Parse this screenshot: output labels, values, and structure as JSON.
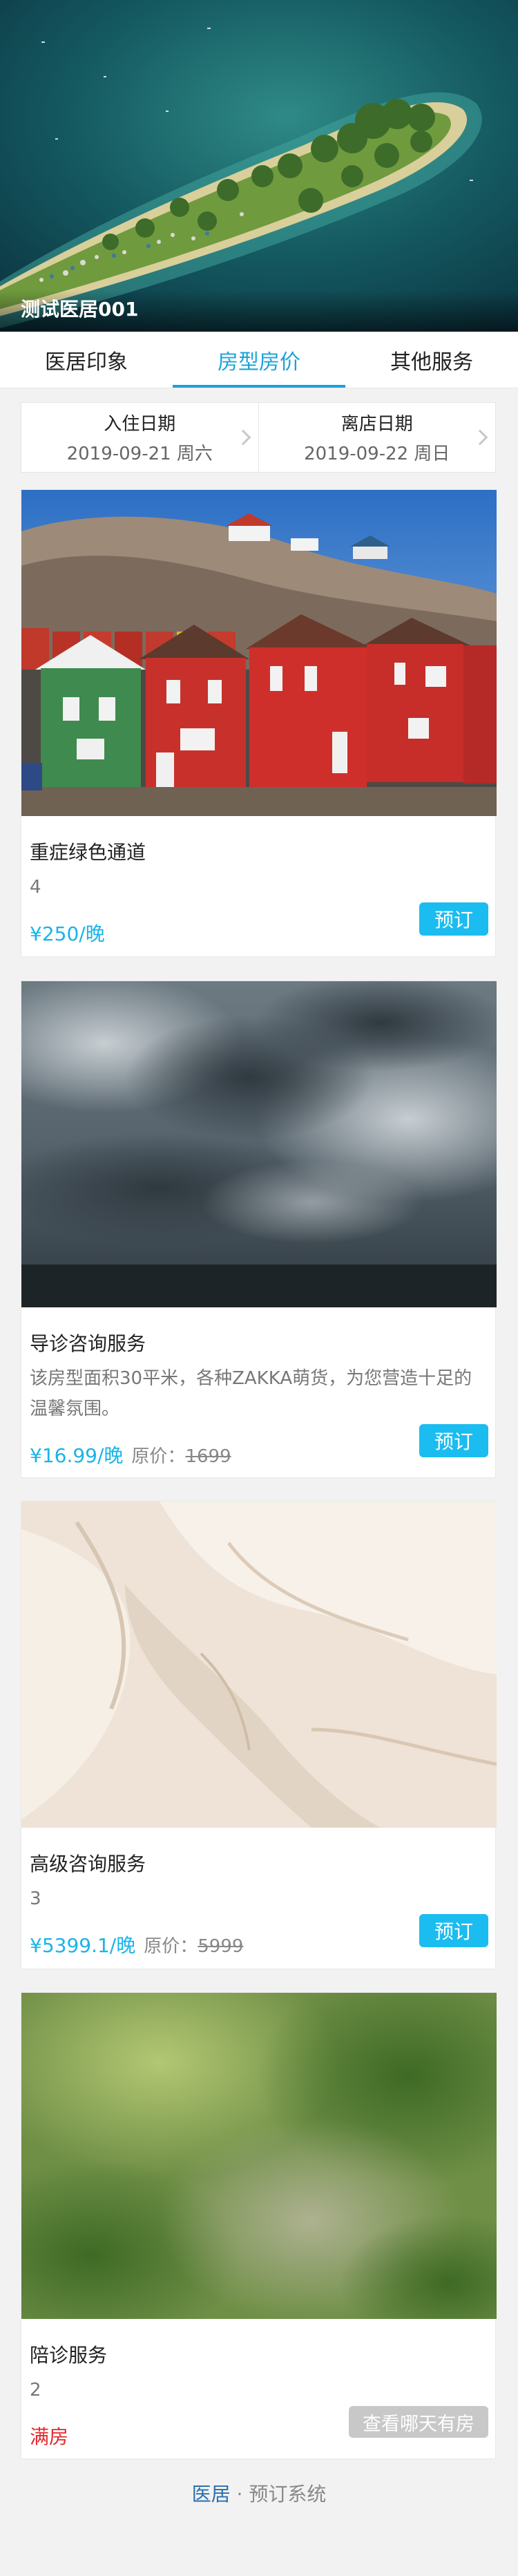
{
  "hero": {
    "title": "测试医居001",
    "image": "aerial-island-photo"
  },
  "tabs": [
    {
      "label": "医居印象",
      "active": false
    },
    {
      "label": "房型房价",
      "active": true
    },
    {
      "label": "其他服务",
      "active": false
    }
  ],
  "dates": {
    "checkin": {
      "label": "入住日期",
      "value": "2019-09-21 周六"
    },
    "checkout": {
      "label": "离店日期",
      "value": "2019-09-22 周日"
    }
  },
  "rooms": [
    {
      "name": "重症绿色通道",
      "desc": "4",
      "price": "¥250/晚",
      "button": "预订",
      "image": "red-cabins-photo"
    },
    {
      "name": "导诊咨询服务",
      "desc": "该房型面积30平米，各种ZAKKA萌货，为您营造十足的温馨氛围。",
      "price": "¥16.99/晚",
      "orig_label": "原价：",
      "orig_value": "1699",
      "button": "预订",
      "image": "storm-clouds-photo"
    },
    {
      "name": "高级咨询服务",
      "desc": "3",
      "price": "¥5399.1/晚",
      "orig_label": "原价：",
      "orig_value": "5999",
      "button": "预订",
      "image": "white-texture-photo"
    },
    {
      "name": "陪诊服务",
      "desc": "2",
      "status": "满房",
      "button": "查看哪天有房",
      "image": "blurred-green-photo"
    }
  ],
  "footer": {
    "brand": "医居",
    "separator": " · ",
    "text": "预订系统"
  },
  "colors": {
    "accent": "#1aa3d9",
    "button": "#1bbcf0",
    "full": "#e0292c",
    "disabled": "#c8c8c8"
  }
}
